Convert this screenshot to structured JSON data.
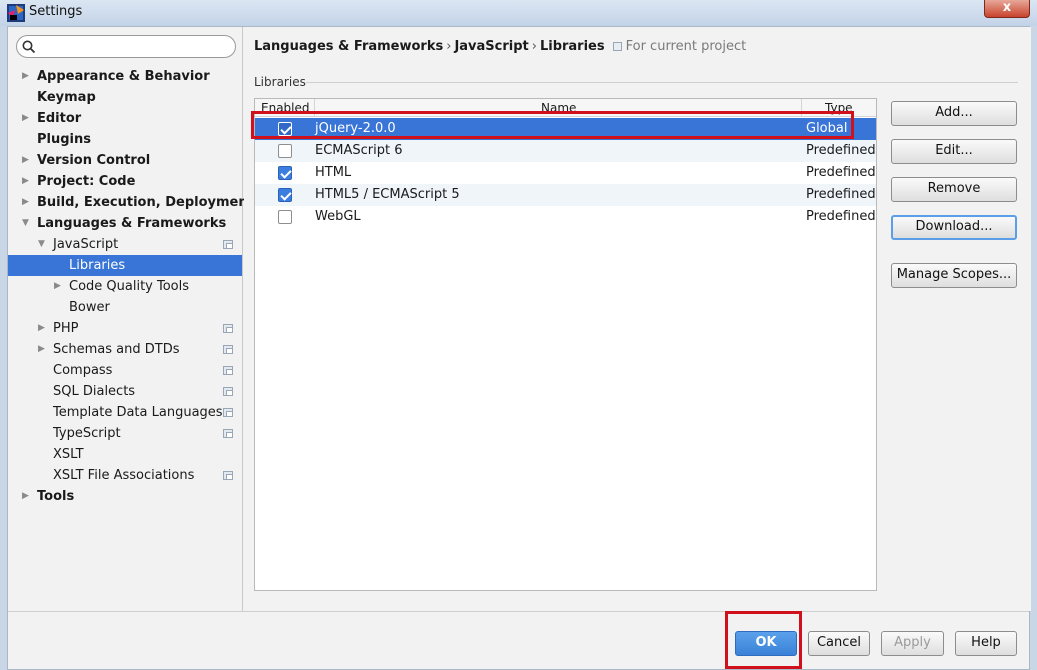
{
  "window": {
    "title": "Settings",
    "close_label": "x"
  },
  "search": {
    "placeholder": "",
    "value": ""
  },
  "sidebar": {
    "items": [
      {
        "label": "Appearance & Behavior",
        "bold": true,
        "arrow": "▶",
        "indent": 0
      },
      {
        "label": "Keymap",
        "bold": true,
        "arrow": "",
        "indent": 0
      },
      {
        "label": "Editor",
        "bold": true,
        "arrow": "▶",
        "indent": 0
      },
      {
        "label": "Plugins",
        "bold": true,
        "arrow": "",
        "indent": 0
      },
      {
        "label": "Version Control",
        "bold": true,
        "arrow": "▶",
        "indent": 0
      },
      {
        "label": "Project: Code",
        "bold": true,
        "arrow": "▶",
        "indent": 0
      },
      {
        "label": "Build, Execution, Deployment",
        "bold": true,
        "arrow": "▶",
        "indent": 0
      },
      {
        "label": "Languages & Frameworks",
        "bold": true,
        "arrow": "▼",
        "indent": 0
      },
      {
        "label": "JavaScript",
        "bold": false,
        "arrow": "▼",
        "indent": 1,
        "project": true
      },
      {
        "label": "Libraries",
        "bold": false,
        "arrow": "",
        "indent": 2,
        "selected": true
      },
      {
        "label": "Code Quality Tools",
        "bold": false,
        "arrow": "▶",
        "indent": 2
      },
      {
        "label": "Bower",
        "bold": false,
        "arrow": "",
        "indent": 2
      },
      {
        "label": "PHP",
        "bold": false,
        "arrow": "▶",
        "indent": 1,
        "project": true
      },
      {
        "label": "Schemas and DTDs",
        "bold": false,
        "arrow": "▶",
        "indent": 1,
        "project": true
      },
      {
        "label": "Compass",
        "bold": false,
        "arrow": "",
        "indent": 1,
        "project": true
      },
      {
        "label": "SQL Dialects",
        "bold": false,
        "arrow": "",
        "indent": 1,
        "project": true
      },
      {
        "label": "Template Data Languages",
        "bold": false,
        "arrow": "",
        "indent": 1,
        "project": true
      },
      {
        "label": "TypeScript",
        "bold": false,
        "arrow": "",
        "indent": 1,
        "project": true
      },
      {
        "label": "XSLT",
        "bold": false,
        "arrow": "",
        "indent": 1
      },
      {
        "label": "XSLT File Associations",
        "bold": false,
        "arrow": "",
        "indent": 1,
        "project": true
      },
      {
        "label": "Tools",
        "bold": true,
        "arrow": "▶",
        "indent": 0
      }
    ]
  },
  "breadcrumb": {
    "parts": [
      "Languages & Frameworks",
      "JavaScript",
      "Libraries"
    ],
    "separator": "›",
    "scope": "For current project"
  },
  "libraries": {
    "section_label": "Libraries",
    "columns": [
      "Enabled",
      "Name",
      "Type"
    ],
    "rows": [
      {
        "enabled": true,
        "name": "jQuery-2.0.0",
        "type": "Global",
        "selected": true
      },
      {
        "enabled": false,
        "name": "ECMAScript 6",
        "type": "Predefined"
      },
      {
        "enabled": true,
        "name": "HTML",
        "type": "Predefined"
      },
      {
        "enabled": true,
        "name": "HTML5 / ECMAScript 5",
        "type": "Predefined"
      },
      {
        "enabled": false,
        "name": "WebGL",
        "type": "Predefined"
      }
    ]
  },
  "side_buttons": {
    "add": "Add...",
    "edit": "Edit...",
    "remove": "Remove",
    "download": "Download...",
    "manage_scopes": "Manage Scopes..."
  },
  "footer": {
    "ok": "OK",
    "cancel": "Cancel",
    "apply": "Apply",
    "help": "Help"
  },
  "colors": {
    "selection": "#3875d6",
    "highlight_annotation": "#d0111b",
    "primary_button": "#3a82d8"
  }
}
